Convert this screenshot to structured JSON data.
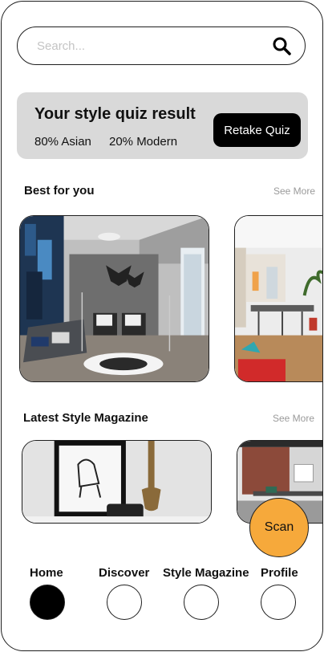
{
  "search": {
    "placeholder": "Search...",
    "icon": "search-icon"
  },
  "quiz": {
    "title": "Your style quiz result",
    "result_1": "80% Asian",
    "result_2": "20% Modern",
    "retake_label": "Retake Quiz"
  },
  "best_for_you": {
    "title": "Best for you",
    "see_more": "See More"
  },
  "latest_magazine": {
    "title": "Latest Style Magazine",
    "see_more": "See More"
  },
  "scan_label": "Scan",
  "nav": {
    "items": [
      {
        "label": "Home",
        "active": true
      },
      {
        "label": "Discover",
        "active": false
      },
      {
        "label": "Style Magazine",
        "active": false
      },
      {
        "label": "Profile",
        "active": false
      }
    ]
  },
  "colors": {
    "accent": "#f6a93b",
    "card_bg": "#d9d9d9",
    "active_nav": "#000000"
  }
}
